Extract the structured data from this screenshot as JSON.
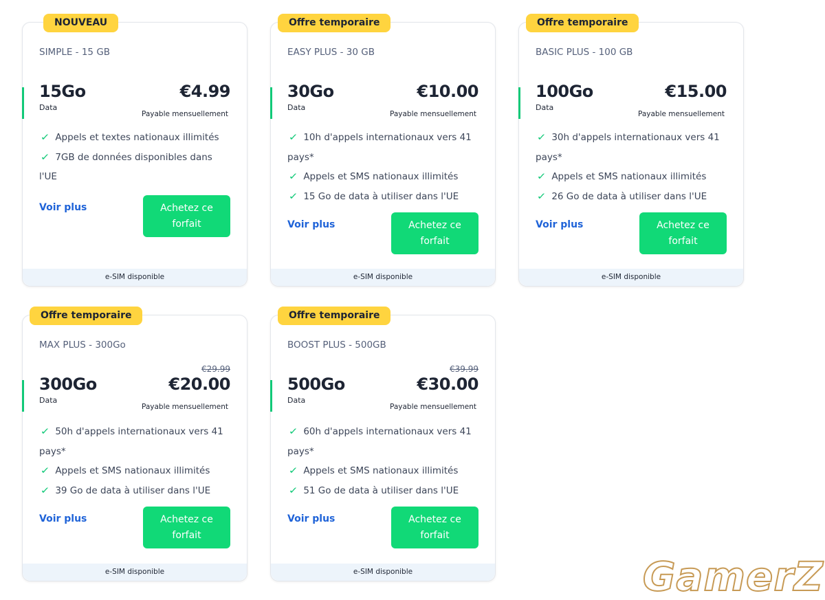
{
  "plans": [
    {
      "badge": "NOUVEAU",
      "name": "SIMPLE - 15 GB",
      "data": "15Go",
      "data_label": "Data",
      "old_price": "",
      "price": "€4.99",
      "payable": "Payable mensuellement",
      "features": [
        "Appels et textes nationaux illimités",
        "7GB de données disponibles dans l'UE"
      ],
      "more_label": "Voir plus",
      "buy_label": "Achetez ce forfait",
      "footer": "e-SIM disponible"
    },
    {
      "badge": "Offre temporaire",
      "name": "EASY PLUS - 30 GB",
      "data": "30Go",
      "data_label": "Data",
      "old_price": "",
      "price": "€10.00",
      "payable": "Payable mensuellement",
      "features": [
        "10h d'appels internationaux vers 41 pays*",
        "Appels et SMS nationaux illimités",
        "15 Go de data à utiliser dans l'UE"
      ],
      "more_label": "Voir plus",
      "buy_label": "Achetez ce forfait",
      "footer": "e-SIM disponible"
    },
    {
      "badge": "Offre temporaire",
      "name": "BASIC PLUS - 100 GB",
      "data": "100Go",
      "data_label": "Data",
      "old_price": "",
      "price": "€15.00",
      "payable": "Payable mensuellement",
      "features": [
        "30h d'appels internationaux vers 41 pays*",
        "Appels et SMS nationaux illimités",
        "26 Go de data à utiliser dans l'UE"
      ],
      "more_label": "Voir plus",
      "buy_label": "Achetez ce forfait",
      "footer": "e-SIM disponible"
    },
    {
      "badge": "Offre temporaire",
      "name": "MAX PLUS - 300Go",
      "data": "300Go",
      "data_label": "Data",
      "old_price": "€29.99",
      "price": "€20.00",
      "payable": "Payable mensuellement",
      "features": [
        "50h d'appels internationaux vers 41 pays*",
        "Appels et SMS nationaux illimités",
        "39 Go de data à utiliser dans l'UE"
      ],
      "more_label": "Voir plus",
      "buy_label": "Achetez ce forfait",
      "footer": "e-SIM disponible"
    },
    {
      "badge": "Offre temporaire",
      "name": "BOOST PLUS - 500GB",
      "data": "500Go",
      "data_label": "Data",
      "old_price": "€39.99",
      "price": "€30.00",
      "payable": "Payable mensuellement",
      "features": [
        "60h d'appels internationaux vers 41 pays*",
        "Appels et SMS nationaux illimités",
        "51 Go de data à utiliser dans l'UE"
      ],
      "more_label": "Voir plus",
      "buy_label": "Achetez ce forfait",
      "footer": "e-SIM disponible"
    }
  ],
  "watermark": "GamerZ",
  "colors": {
    "accent_green": "#11c978",
    "button_green": "#11d977",
    "badge_yellow": "#ffd43f",
    "link_blue": "#1f63d8",
    "footer_bg": "#edf4fb"
  },
  "icons": {
    "feature_bullet": "check-icon"
  }
}
